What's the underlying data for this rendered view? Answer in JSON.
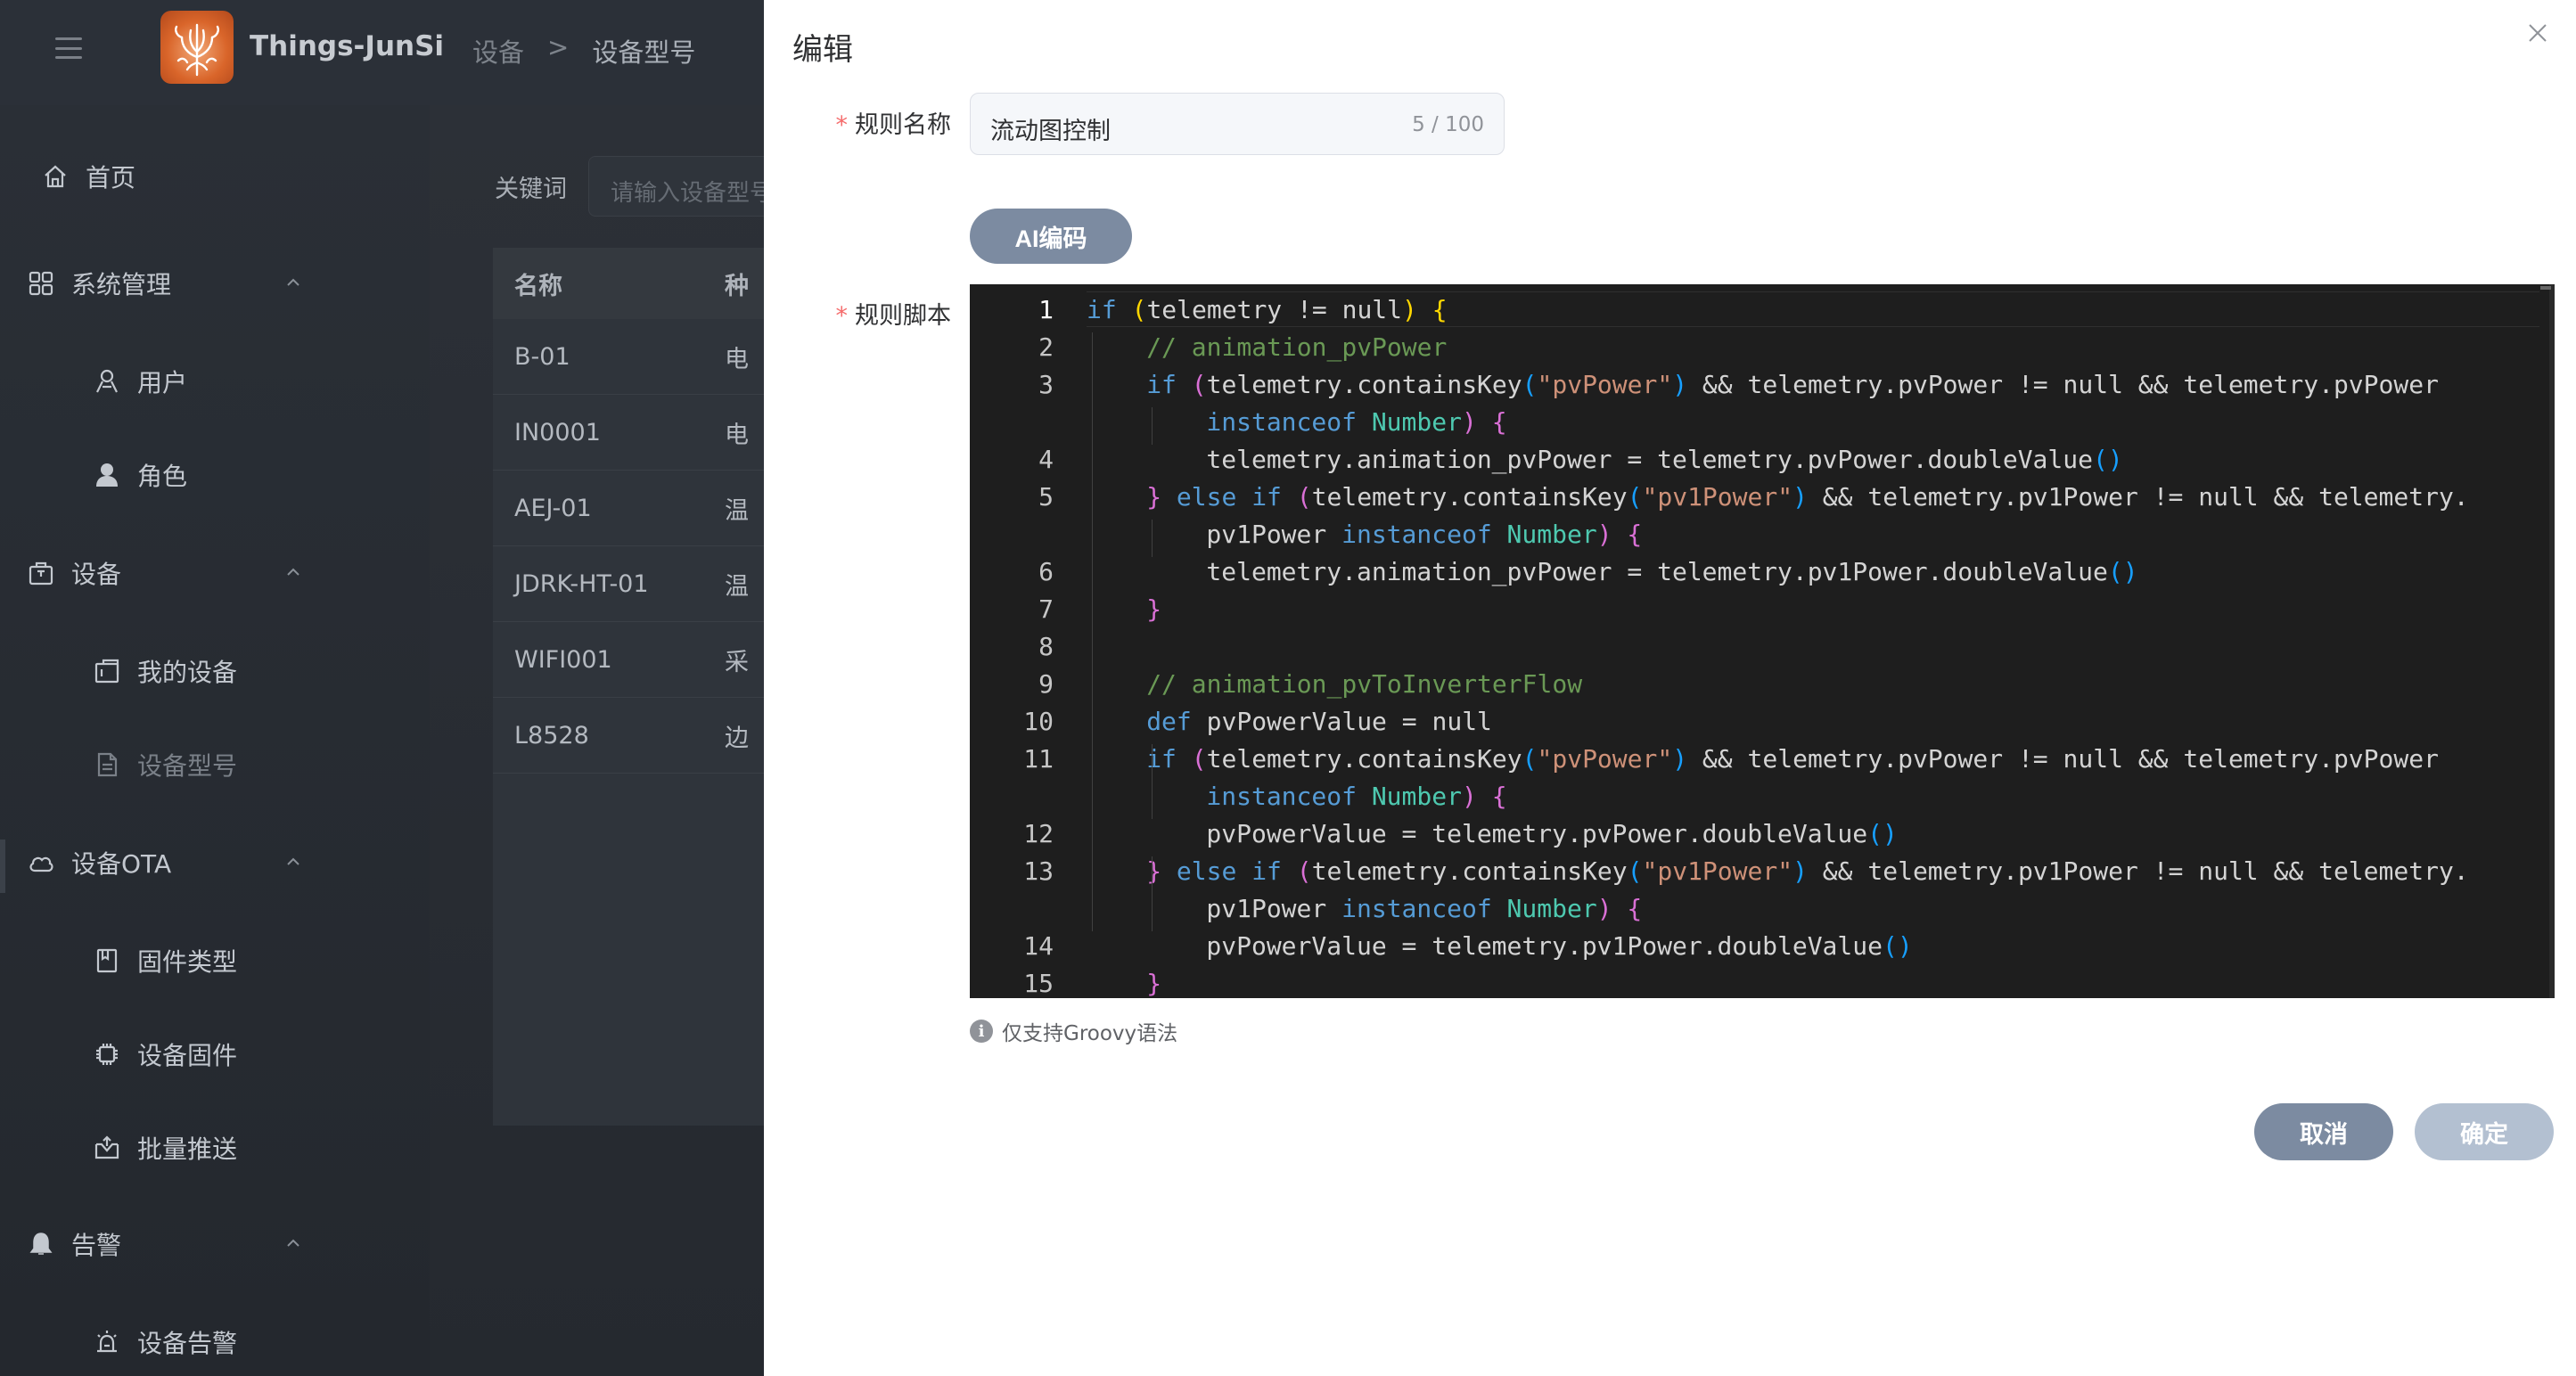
{
  "header": {
    "app_title": "Things-JunSi",
    "breadcrumb": [
      "设备",
      ">",
      "设备型号"
    ]
  },
  "sidebar": {
    "items": [
      {
        "label": "首页",
        "icon": "home-icon"
      },
      {
        "label": "系统管理",
        "icon": "grid-icon"
      },
      {
        "label": "用户",
        "icon": "user-outline-icon"
      },
      {
        "label": "角色",
        "icon": "user-filled-icon"
      },
      {
        "label": "设备",
        "icon": "box-icon"
      },
      {
        "label": "我的设备",
        "icon": "device-icon"
      },
      {
        "label": "设备型号",
        "icon": "document-icon"
      },
      {
        "label": "设备OTA",
        "icon": "cloud-icon"
      },
      {
        "label": "固件类型",
        "icon": "notebook-icon"
      },
      {
        "label": "设备固件",
        "icon": "chip-icon"
      },
      {
        "label": "批量推送",
        "icon": "inbox-icon"
      },
      {
        "label": "告警",
        "icon": "bell-icon"
      },
      {
        "label": "设备告警",
        "icon": "alarm-icon"
      }
    ]
  },
  "search": {
    "label": "关键词",
    "placeholder": "请输入设备型号"
  },
  "table": {
    "headers": [
      "名称",
      "种"
    ],
    "rows": [
      {
        "name": "B-01",
        "type": "电"
      },
      {
        "name": "IN0001",
        "type": "电"
      },
      {
        "name": "AEJ-01",
        "type": "温"
      },
      {
        "name": "JDRK-HT-01",
        "type": "温"
      },
      {
        "name": "WIFI001",
        "type": "采"
      },
      {
        "name": "L8528",
        "type": "边"
      }
    ]
  },
  "drawer": {
    "title": "编辑",
    "name_label": "规则名称",
    "name_value": "流动图控制",
    "name_count": "5 / 100",
    "ai_button": "AI编码",
    "script_label": "规则脚本",
    "line_numbers": [
      "1",
      "2",
      "3",
      "",
      "4",
      "5",
      "",
      "6",
      "7",
      "8",
      "9",
      "10",
      "11",
      "",
      "12",
      "13",
      "",
      "14",
      "15"
    ],
    "hint": "仅支持Groovy语法",
    "cancel": "取消",
    "confirm": "确定"
  },
  "colors": {
    "primary_button": "#7c8ba1",
    "disabled_button": "#b3c0d1",
    "required_mark": "#f56c6c",
    "editor_bg": "#1e1e1e"
  }
}
